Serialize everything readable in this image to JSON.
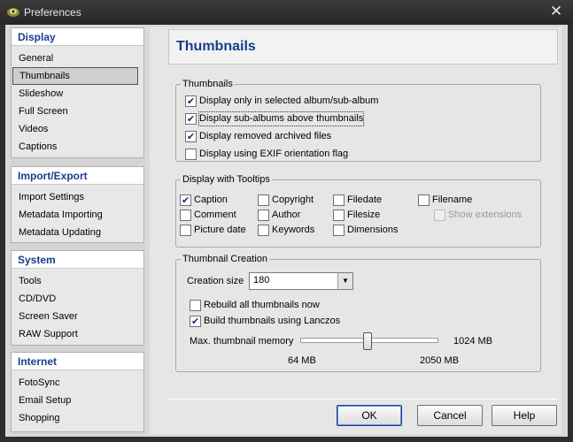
{
  "window": {
    "title": "Preferences",
    "close_glyph": "✕"
  },
  "sidebar": {
    "sections": [
      {
        "title": "Display",
        "items": [
          "General",
          "Thumbnails",
          "Slideshow",
          "Full Screen",
          "Videos",
          "Captions"
        ],
        "selected": "Thumbnails"
      },
      {
        "title": "Import/Export",
        "items": [
          "Import Settings",
          "Metadata Importing",
          "Metadata Updating"
        ]
      },
      {
        "title": "System",
        "items": [
          "Tools",
          "CD/DVD",
          "Screen Saver",
          "RAW Support"
        ]
      },
      {
        "title": "Internet",
        "items": [
          "FotoSync",
          "Email Setup",
          "Shopping"
        ]
      }
    ]
  },
  "page": {
    "title": "Thumbnails"
  },
  "thumbnails_group": {
    "label": "Thumbnails",
    "options": [
      {
        "label": "Display only in selected album/sub-album",
        "checked": true
      },
      {
        "label": "Display sub-albums above thumbnails",
        "checked": true
      },
      {
        "label": "Display removed archived files",
        "checked": true
      },
      {
        "label": "Display using EXIF orientation flag",
        "checked": false
      }
    ]
  },
  "tooltips_group": {
    "label": "Display with Tooltips",
    "options": {
      "caption": {
        "label": "Caption",
        "checked": true
      },
      "comment": {
        "label": "Comment",
        "checked": false
      },
      "picture_date": {
        "label": "Picture date",
        "checked": false
      },
      "copyright": {
        "label": "Copyright",
        "checked": false
      },
      "author": {
        "label": "Author",
        "checked": false
      },
      "keywords": {
        "label": "Keywords",
        "checked": false
      },
      "filedate": {
        "label": "Filedate",
        "checked": false
      },
      "filesize": {
        "label": "Filesize",
        "checked": false
      },
      "dimensions": {
        "label": "Dimensions",
        "checked": false
      },
      "filename": {
        "label": "Filename",
        "checked": false
      },
      "show_extensions": {
        "label": "Show extensions",
        "checked": false,
        "disabled": true
      }
    }
  },
  "creation_group": {
    "label": "Thumbnail Creation",
    "size_label": "Creation size",
    "size_value": "180",
    "rebuild": {
      "label": "Rebuild all thumbnails now",
      "checked": false
    },
    "lanczos": {
      "label": "Build thumbnails using Lanczos",
      "checked": true
    },
    "memory_label": "Max. thumbnail memory",
    "memory_value_label": "1024 MB",
    "memory_min_label": "64 MB",
    "memory_max_label": "2050 MB",
    "memory_value_mb": 1024,
    "memory_min_mb": 64,
    "memory_max_mb": 2050
  },
  "buttons": {
    "ok": "OK",
    "cancel": "Cancel",
    "help": "Help"
  },
  "colors": {
    "accent": "#1a3c8c",
    "titlebar": "#2e2e2e"
  }
}
